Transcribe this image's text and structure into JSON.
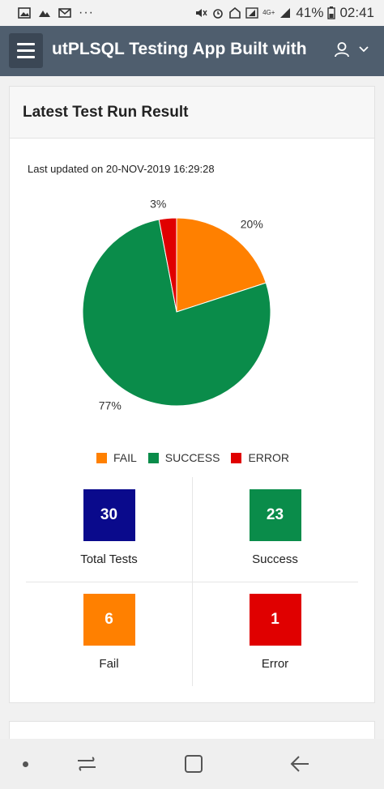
{
  "status_bar": {
    "left_icons": [
      "image-icon",
      "signal-dots-icon",
      "gmail-icon",
      "more-icon"
    ],
    "more": "···",
    "network": "4G+",
    "battery_percent": "41%",
    "time": "02:41"
  },
  "header": {
    "title": "utPLSQL Testing App Built with"
  },
  "card": {
    "title": "Latest Test Run Result",
    "last_updated": "Last updated on 20-NOV-2019 16:29:28"
  },
  "chart_data": {
    "type": "pie",
    "slices": [
      {
        "name": "FAIL",
        "value": 20,
        "label": "20%",
        "color": "#ff8000"
      },
      {
        "name": "SUCCESS",
        "value": 77,
        "label": "77%",
        "color": "#0a8c4a"
      },
      {
        "name": "ERROR",
        "value": 3,
        "label": "3%",
        "color": "#e00000"
      }
    ],
    "legend": [
      "FAIL",
      "SUCCESS",
      "ERROR"
    ],
    "legend_position": "bottom"
  },
  "stats": [
    {
      "value": "30",
      "label": "Total Tests",
      "color": "#0a0a8c"
    },
    {
      "value": "23",
      "label": "Success",
      "color": "#0a8c4a"
    },
    {
      "value": "6",
      "label": "Fail",
      "color": "#ff8000"
    },
    {
      "value": "1",
      "label": "Error",
      "color": "#e00000"
    }
  ]
}
